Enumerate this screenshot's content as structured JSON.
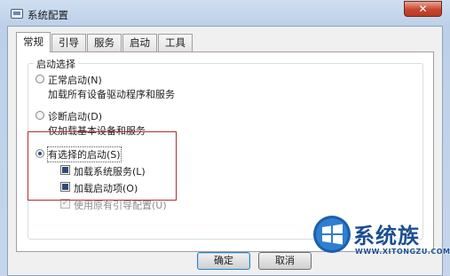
{
  "window": {
    "title": "系统配置",
    "close_symbol": "✕"
  },
  "tabs": [
    {
      "label": "常规",
      "active": true
    },
    {
      "label": "引导",
      "active": false
    },
    {
      "label": "服务",
      "active": false
    },
    {
      "label": "启动",
      "active": false
    },
    {
      "label": "工具",
      "active": false
    }
  ],
  "startup": {
    "group_title": "启动选择",
    "normal": {
      "label": "正常启动(N)",
      "description": "加载所有设备驱动程序和服务",
      "checked": false
    },
    "diagnostic": {
      "label": "诊断启动(D)",
      "description": "仅加载基本设备和服务",
      "checked": false
    },
    "selective": {
      "label": "有选择的启动(S)",
      "checked": true,
      "options": [
        {
          "label": "加载系统服务(L)",
          "checked": true,
          "enabled": true
        },
        {
          "label": "加载启动项(O)",
          "checked": true,
          "enabled": true
        },
        {
          "label": "使用原有引导配置(U)",
          "checked": true,
          "enabled": false
        }
      ]
    }
  },
  "buttons": {
    "ok": "确定",
    "cancel": "取消"
  },
  "watermark": {
    "text": "系统族",
    "url": "WWW.XITONGZU.COM"
  },
  "colors": {
    "highlight_border": "#b22d2d",
    "accent": "#1c4f90",
    "close_button": "#c8452e"
  }
}
